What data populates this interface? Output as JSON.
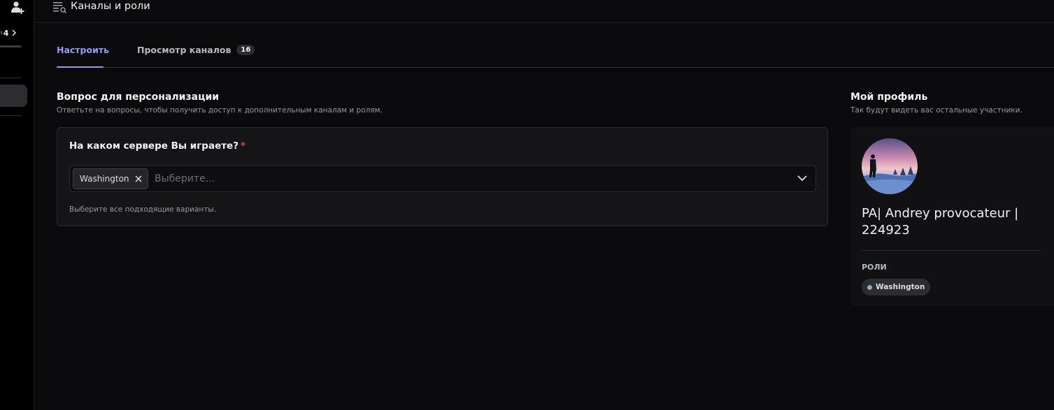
{
  "sidebar": {
    "add_member_icon": "add-user-icon",
    "progress_prefix": "з",
    "progress_count": "4",
    "chevron_icon": "chevron-right-icon"
  },
  "topbar": {
    "icon": "channel-browse-icon",
    "title": "Каналы и роли"
  },
  "tabs": {
    "configure": "Настроить",
    "browse": "Просмотр каналов",
    "browse_count": "16",
    "active": "configure"
  },
  "questions_section": {
    "title": "Вопрос для персонализации",
    "subtitle": "Ответьте на вопросы, чтобы получить доступ к дополнительным каналам и ролям.",
    "question": {
      "title": "На каком сервере Вы играете?",
      "required_mark": "*",
      "selected": [
        "Washington"
      ],
      "placeholder": "Выберите...",
      "hint": "Выберите все подходящие варианты."
    }
  },
  "profile_section": {
    "title": "Мой профиль",
    "subtitle": "Так будут видеть вас остальные участники.",
    "name": "PA| Andrey provocateur | 224923",
    "roles_label": "РОЛИ",
    "roles": [
      {
        "name": "Washington",
        "color": "#99aab5"
      }
    ]
  },
  "colors": {
    "accent": "#949cf7",
    "required": "#f23f43"
  }
}
